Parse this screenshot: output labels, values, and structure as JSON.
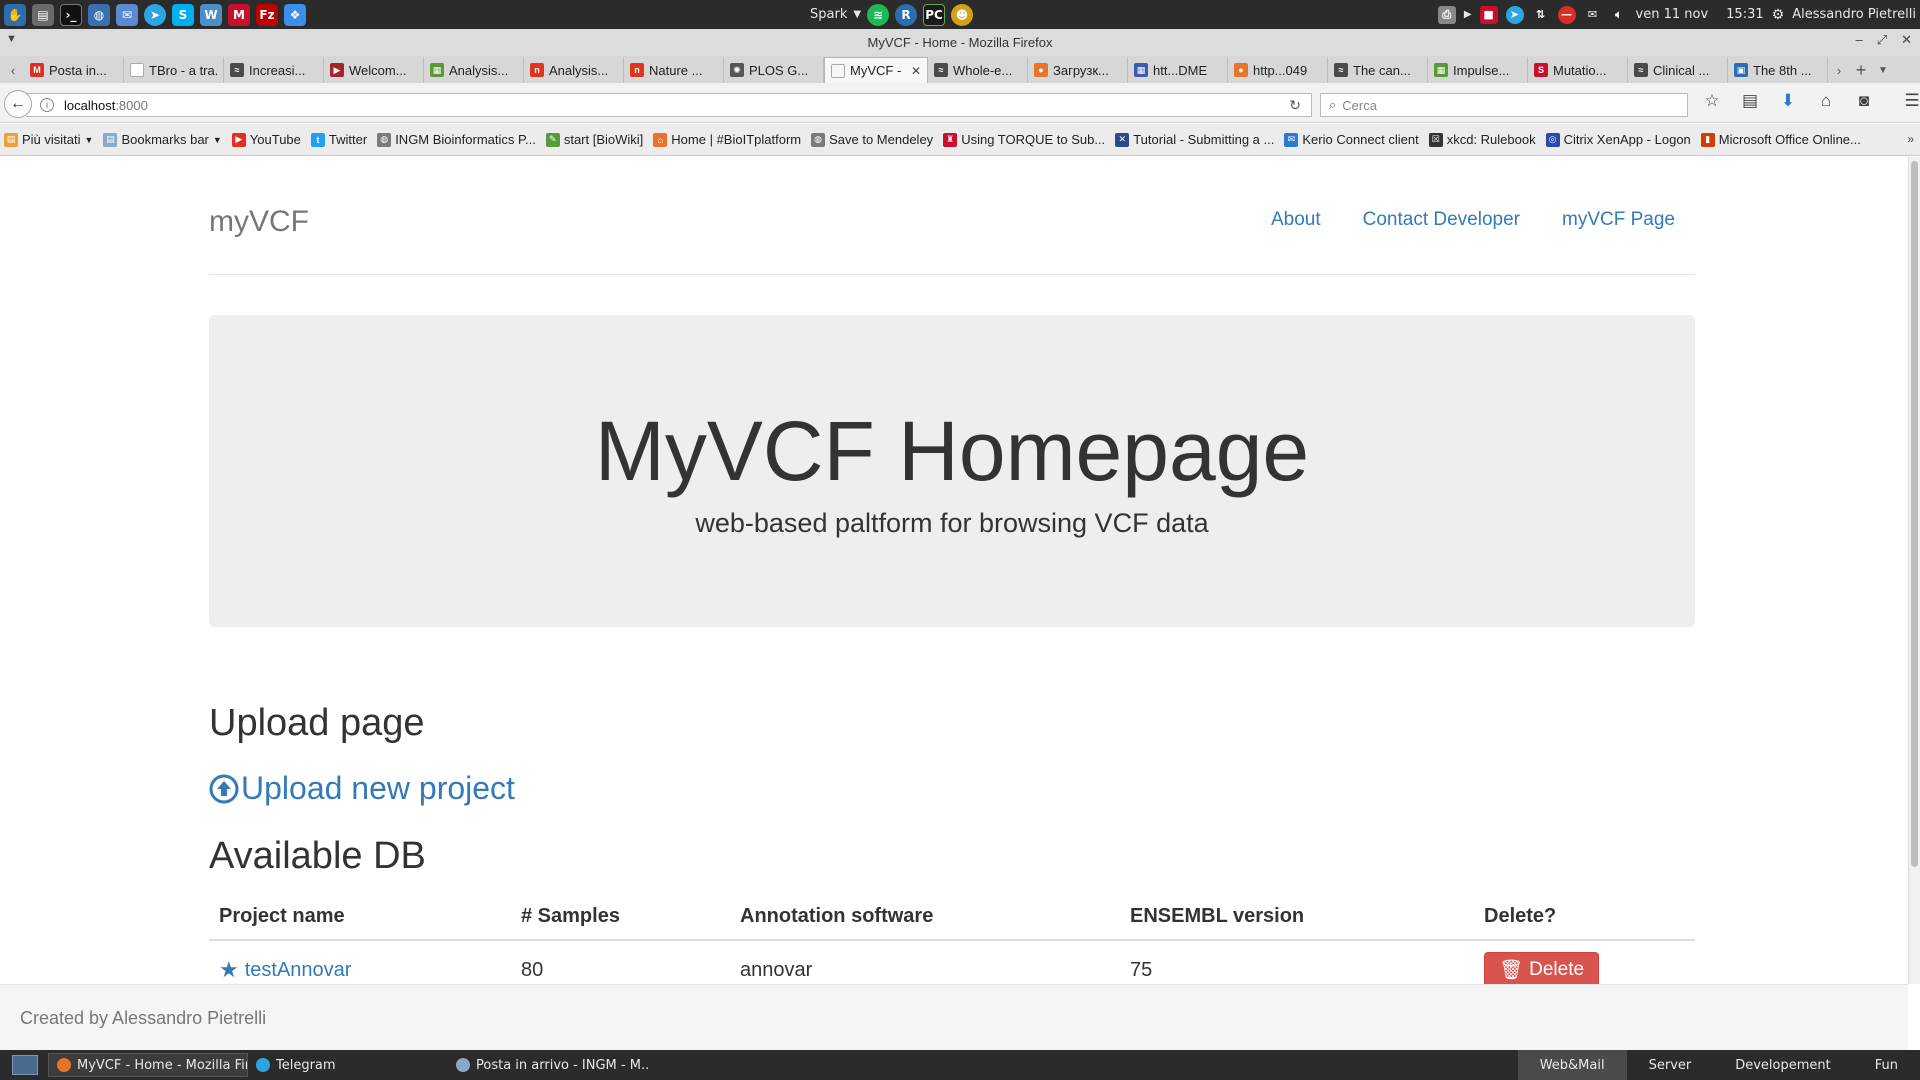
{
  "os_panel": {
    "center_label": "Spark",
    "clock": "ven 11 nov",
    "time": "15:31",
    "user": "Alessandro Pietrelli"
  },
  "window": {
    "title": "MyVCF - Home - Mozilla Firefox"
  },
  "tabs": [
    {
      "label": "Posta in...",
      "icon_color": "#d93025",
      "icon": "gmail-icon",
      "glyph": "M"
    },
    {
      "label": "TBro - a tra...",
      "icon_color": "#ffffff",
      "icon": "blank-page-icon",
      "glyph": ""
    },
    {
      "label": "Increasi...",
      "icon_color": "#4a4a4a",
      "icon": "crossref-icon",
      "glyph": "≈"
    },
    {
      "label": "Welcom...",
      "icon_color": "#a0282a",
      "icon": "bookmark-red-icon",
      "glyph": "▶"
    },
    {
      "label": "Analysis...",
      "icon_color": "#5a9a3a",
      "icon": "chart-icon",
      "glyph": "▦"
    },
    {
      "label": "Analysis...",
      "icon_color": "#e0341e",
      "icon": "oxford-icon",
      "glyph": "n"
    },
    {
      "label": "Nature ...",
      "icon_color": "#e0341e",
      "icon": "nature-icon",
      "glyph": "n"
    },
    {
      "label": "PLOS G...",
      "icon_color": "#555555",
      "icon": "plos-icon",
      "glyph": "✺"
    },
    {
      "label": "MyVCF - ...",
      "icon_color": "#f7f7f7",
      "icon": "blank-page-icon",
      "glyph": "",
      "active": true
    },
    {
      "label": "Whole-e...",
      "icon_color": "#4a4a4a",
      "icon": "crossref-icon",
      "glyph": "≈"
    },
    {
      "label": "Загрузк...",
      "icon_color": "#e8732a",
      "icon": "ubuntu-icon",
      "glyph": "●"
    },
    {
      "label": "htt...DME",
      "icon_color": "#3b5ea8",
      "icon": "grid-icon",
      "glyph": "▦"
    },
    {
      "label": "http...049",
      "icon_color": "#e8732a",
      "icon": "ubuntu-icon",
      "glyph": "●"
    },
    {
      "label": "The can...",
      "icon_color": "#4a4a4a",
      "icon": "crossref-icon",
      "glyph": "≈"
    },
    {
      "label": "Impulse...",
      "icon_color": "#5a9a3a",
      "icon": "chart-icon",
      "glyph": "▦"
    },
    {
      "label": "Mutatio...",
      "icon_color": "#c8102e",
      "icon": "springer-icon",
      "glyph": "S"
    },
    {
      "label": "Clinical ...",
      "icon_color": "#4a4a4a",
      "icon": "crossref-icon",
      "glyph": "≈"
    },
    {
      "label": "The 8th ...",
      "icon_color": "#2a6db0",
      "icon": "doc-icon",
      "glyph": "▣"
    }
  ],
  "navbar": {
    "url_host": "localhost",
    "url_port": ":8000",
    "search_placeholder": "Cerca"
  },
  "bookmarks": [
    {
      "label": "Più visitati",
      "icon": "folder-icon",
      "color": "#e8a23a",
      "glyph": "▤",
      "dropdown": true
    },
    {
      "label": "Bookmarks bar",
      "icon": "folder-icon",
      "color": "#8aa8c8",
      "glyph": "▤",
      "dropdown": true
    },
    {
      "label": "YouTube",
      "icon": "youtube-icon",
      "color": "#e52d27",
      "glyph": "▶"
    },
    {
      "label": "Twitter",
      "icon": "twitter-icon",
      "color": "#1da1f2",
      "glyph": "t"
    },
    {
      "label": "INGM Bioinformatics P...",
      "icon": "globe-icon",
      "color": "#7a7a7a",
      "glyph": "◍"
    },
    {
      "label": "start [BioWiki]",
      "icon": "wiki-icon",
      "color": "#5a9a3a",
      "glyph": "✎"
    },
    {
      "label": "Home | #BioITplatform",
      "icon": "home-icon",
      "color": "#e8732a",
      "glyph": "⌂"
    },
    {
      "label": "Save to Mendeley",
      "icon": "globe-icon",
      "color": "#7a7a7a",
      "glyph": "◍"
    },
    {
      "label": "Using TORQUE to Sub...",
      "icon": "university-icon",
      "color": "#c8102e",
      "glyph": "♜"
    },
    {
      "label": "Tutorial - Submitting a ...",
      "icon": "x-icon",
      "color": "#2a4a8a",
      "glyph": "✕"
    },
    {
      "label": "Kerio Connect client",
      "icon": "mail-icon",
      "color": "#2a7ad0",
      "glyph": "✉"
    },
    {
      "label": "xkcd: Rulebook",
      "icon": "xkcd-icon",
      "color": "#333333",
      "glyph": "☒"
    },
    {
      "label": "Citrix XenApp - Logon",
      "icon": "citrix-icon",
      "color": "#2a4aa8",
      "glyph": "◎"
    },
    {
      "label": "Microsoft Office Online...",
      "icon": "office-icon",
      "color": "#d83b01",
      "glyph": "▮"
    }
  ],
  "page": {
    "brand": "myVCF",
    "nav": [
      {
        "label": "About"
      },
      {
        "label": "Contact Developer"
      },
      {
        "label": "myVCF Page"
      }
    ],
    "jumbotron": {
      "title": "MyVCF Homepage",
      "subtitle": "web-based paltform for browsing VCF data"
    },
    "upload_heading": "Upload page",
    "upload_link": "Upload new project",
    "db_heading": "Available DB",
    "table": {
      "columns": [
        "Project name",
        "# Samples",
        "Annotation software",
        "ENSEMBL version",
        "Delete?"
      ],
      "rows": [
        {
          "project": "testAnnovar",
          "samples": "80",
          "software": "annovar",
          "ensembl": "75",
          "delete_label": "Delete"
        }
      ]
    },
    "footer": "Created by Alessandro Pietrelli"
  },
  "taskbar": {
    "tasks": [
      {
        "label": "MyVCF - Home - Mozilla Fir...",
        "active": true,
        "color": "#e8732a"
      },
      {
        "label": "Telegram",
        "active": false,
        "color": "#2ca5e0"
      },
      {
        "label": "Posta in arrivo - INGM - M...",
        "active": false,
        "color": "#8aa8c8"
      }
    ],
    "workspaces": [
      {
        "label": "Web&Mail",
        "active": true
      },
      {
        "label": "Server",
        "active": false
      },
      {
        "label": "Developement",
        "active": false
      },
      {
        "label": "Fun",
        "active": false
      }
    ]
  },
  "colors": {
    "link": "#337ab7",
    "danger": "#d9534f",
    "jumbotron_bg": "#eeeeee"
  }
}
